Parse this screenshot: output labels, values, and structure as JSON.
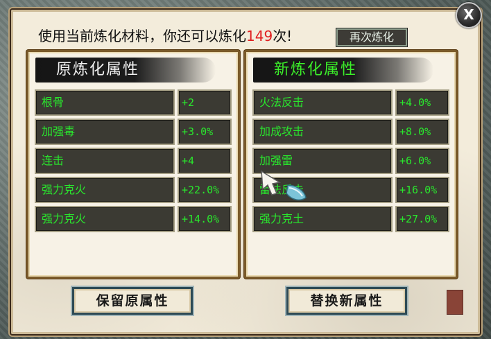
{
  "dialog": {
    "close_label": "X",
    "message_prefix": "使用当前炼化材料，你还可以炼化",
    "remaining_count": "149",
    "message_suffix": "次!",
    "refine_again_label": "再次炼化"
  },
  "original": {
    "title": "原炼化属性",
    "rows": [
      {
        "name": "根骨",
        "value": "+2"
      },
      {
        "name": "加强毒",
        "value": "+3.0%"
      },
      {
        "name": "连击",
        "value": "+4"
      },
      {
        "name": "强力克火",
        "value": "+22.0%"
      },
      {
        "name": "强力克火",
        "value": "+14.0%"
      }
    ]
  },
  "new": {
    "title": "新炼化属性",
    "rows": [
      {
        "name": "火法反击",
        "value": "+4.0%"
      },
      {
        "name": "加成攻击",
        "value": "+8.0%"
      },
      {
        "name": "加强雷",
        "value": "+6.0%"
      },
      {
        "name": "雷法反击",
        "value": "+16.0%"
      },
      {
        "name": "强力克土",
        "value": "+27.0%"
      }
    ]
  },
  "buttons": {
    "keep_label": "保留原属性",
    "swap_label": "替换新属性"
  },
  "colors": {
    "attribute_text": "#29e82d",
    "new_title": "#3cf02a",
    "count_highlight": "#e02020"
  }
}
